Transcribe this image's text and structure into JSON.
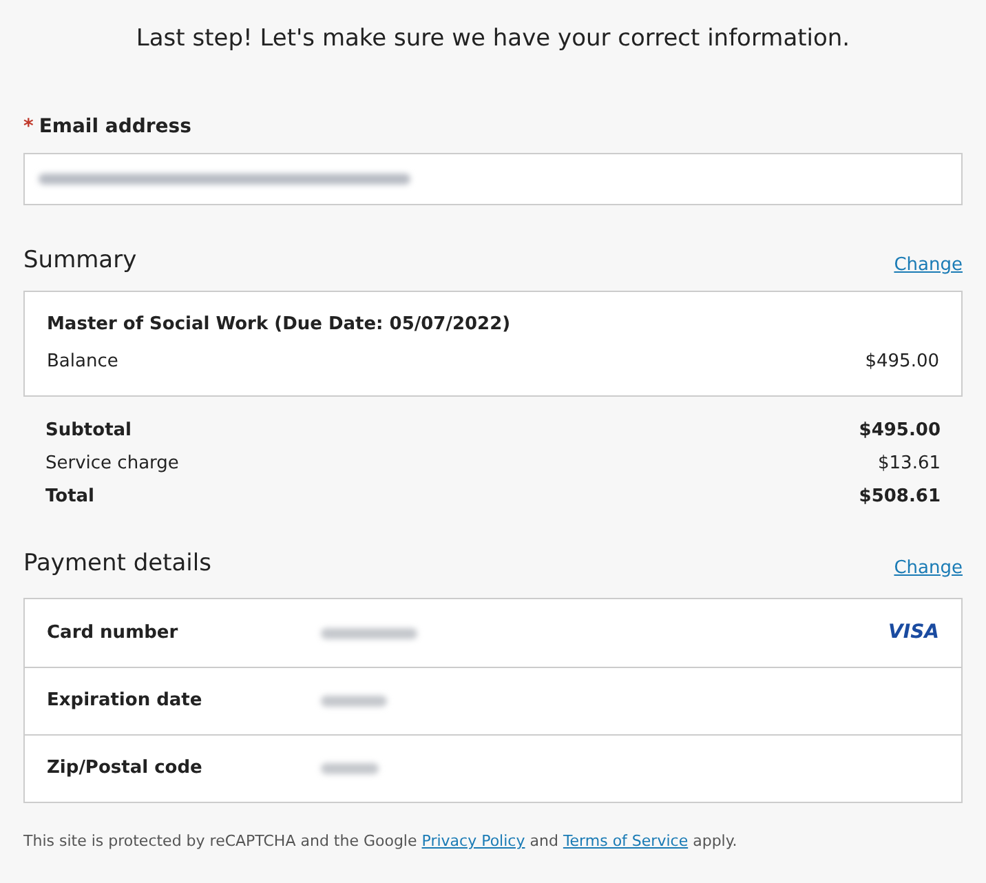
{
  "title": "Last step! Let's make sure we have your correct information.",
  "email": {
    "required_mark": "*",
    "label": "Email address"
  },
  "summary": {
    "heading": "Summary",
    "change_link": "Change",
    "item": {
      "title": "Master of Social Work (Due Date: 05/07/2022)",
      "label": "Balance",
      "amount": "$495.00"
    },
    "totals": [
      {
        "label": "Subtotal",
        "amount": "$495.00",
        "bold": true
      },
      {
        "label": "Service charge",
        "amount": "$13.61",
        "bold": false
      },
      {
        "label": "Total",
        "amount": "$508.61",
        "bold": true
      }
    ]
  },
  "payment": {
    "heading": "Payment details",
    "change_link": "Change",
    "rows": [
      {
        "label": "Card number",
        "brand": "VISA"
      },
      {
        "label": "Expiration date"
      },
      {
        "label": "Zip/Postal code"
      }
    ]
  },
  "footer": {
    "before": "This site is protected by reCAPTCHA and the Google",
    "privacy_link": "Privacy Policy",
    "middle": "and",
    "terms_link": "Terms of Service",
    "after": "apply."
  }
}
